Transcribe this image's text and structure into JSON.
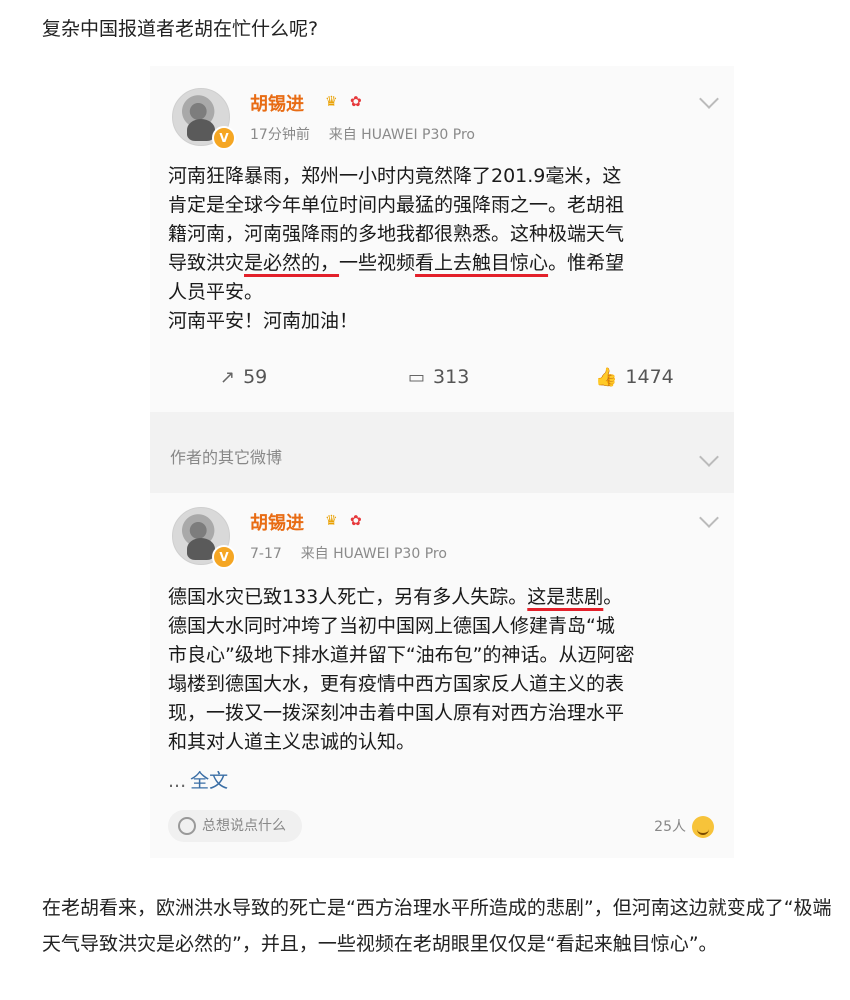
{
  "header_text": "复杂中国报道者老胡在忙什么呢?",
  "post1": {
    "username": "胡锡进",
    "time": "17分钟前",
    "source": "来自 HUAWEI P30 Pro",
    "line1": "河南狂降暴雨，郑州一小时内竟然降了201.9毫米，这",
    "line2": "肯定是全球今年单位时间内最猛的强降雨之一。老胡祖",
    "line3": "籍河南，河南强降雨的多地我都很熟悉。这种极端天气",
    "line4a": "导致洪灾",
    "line4b": "是必然的，",
    "line4c": "一些视频",
    "line4d": "看上去触目惊心",
    "line4e": "。惟希望",
    "line5": "人员平安。",
    "line6": "河南平安！河南加油！",
    "reposts": "59",
    "comments": "313",
    "likes": "1474"
  },
  "section_title": "作者的其它微博",
  "post2": {
    "username": "胡锡进",
    "time": "7-17",
    "source": "来自 HUAWEI P30 Pro",
    "line1a": "德国水灾已致133人死亡，另有多人失踪。",
    "line1b": "这是悲剧",
    "line1c": "。",
    "line2": "德国大水同时冲垮了当初中国网上德国人修建青岛“城",
    "line3": "市良心”级地下排水道并留下“油布包”的神话。从迈阿密",
    "line4": "塌楼到德国大水，更有疫情中西方国家反人道主义的表",
    "line5": "现，一拨又一拨深刻冲击着中国人原有对西方治理水平",
    "line6": "和其对人道主义忠诚的认知。",
    "ellipsis": "...",
    "full_text_link": "全文",
    "comment_prompt": "总想说点什么",
    "people_count": "25人"
  },
  "bottom_text": "在老胡看来，欧洲洪水导致的死亡是“西方治理水平所造成的悲剧”，但河南这边就变成了“极端天气导致洪灾是必然的”，并且，一些视频在老胡眼里仅仅是“看起来触目惊心”。"
}
